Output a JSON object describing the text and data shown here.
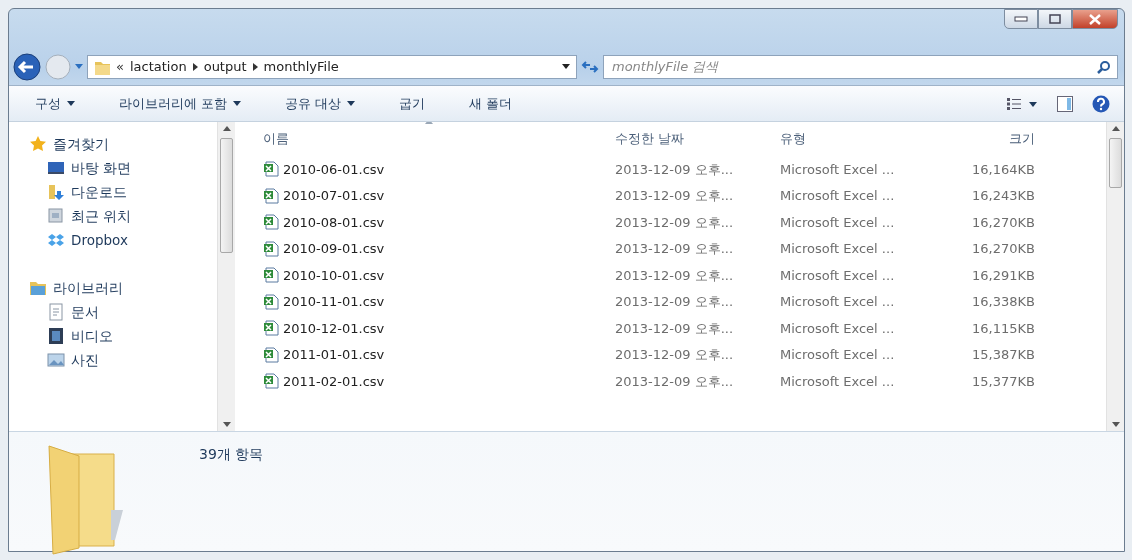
{
  "address_bar": {
    "overflow": "«",
    "path": [
      "lactation",
      "output",
      "monthlyFile"
    ]
  },
  "search": {
    "placeholder": "monthlyFile 검색"
  },
  "toolbar": {
    "buttons": [
      {
        "label": "구성",
        "dropdown": true
      },
      {
        "label": "라이브러리에 포함",
        "dropdown": true
      },
      {
        "label": "공유 대상",
        "dropdown": true
      },
      {
        "label": "굽기",
        "dropdown": false
      },
      {
        "label": "새 폴더",
        "dropdown": false
      }
    ]
  },
  "sidebar": {
    "groups": [
      {
        "label": "즐겨찾기",
        "children": [
          {
            "label": "바탕 화면"
          },
          {
            "label": "다운로드"
          },
          {
            "label": "최근 위치"
          },
          {
            "label": "Dropbox"
          }
        ]
      },
      {
        "label": "라이브러리",
        "children": [
          {
            "label": "문서"
          },
          {
            "label": "비디오"
          },
          {
            "label": "사진"
          }
        ]
      }
    ]
  },
  "table": {
    "columns": [
      "이름",
      "수정한 날짜",
      "유형",
      "크기"
    ],
    "rows": [
      [
        "2010-06-01.csv",
        "2013-12-09 오후...",
        "Microsoft Excel ...",
        "16,164KB"
      ],
      [
        "2010-07-01.csv",
        "2013-12-09 오후...",
        "Microsoft Excel ...",
        "16,243KB"
      ],
      [
        "2010-08-01.csv",
        "2013-12-09 오후...",
        "Microsoft Excel ...",
        "16,270KB"
      ],
      [
        "2010-09-01.csv",
        "2013-12-09 오후...",
        "Microsoft Excel ...",
        "16,270KB"
      ],
      [
        "2010-10-01.csv",
        "2013-12-09 오후...",
        "Microsoft Excel ...",
        "16,291KB"
      ],
      [
        "2010-11-01.csv",
        "2013-12-09 오후...",
        "Microsoft Excel ...",
        "16,338KB"
      ],
      [
        "2010-12-01.csv",
        "2013-12-09 오후...",
        "Microsoft Excel ...",
        "16,115KB"
      ],
      [
        "2011-01-01.csv",
        "2013-12-09 오후...",
        "Microsoft Excel ...",
        "15,387KB"
      ],
      [
        "2011-02-01.csv",
        "2013-12-09 오후...",
        "Microsoft Excel ...",
        "15,377KB"
      ]
    ]
  },
  "details": {
    "count": "39개 항목"
  }
}
